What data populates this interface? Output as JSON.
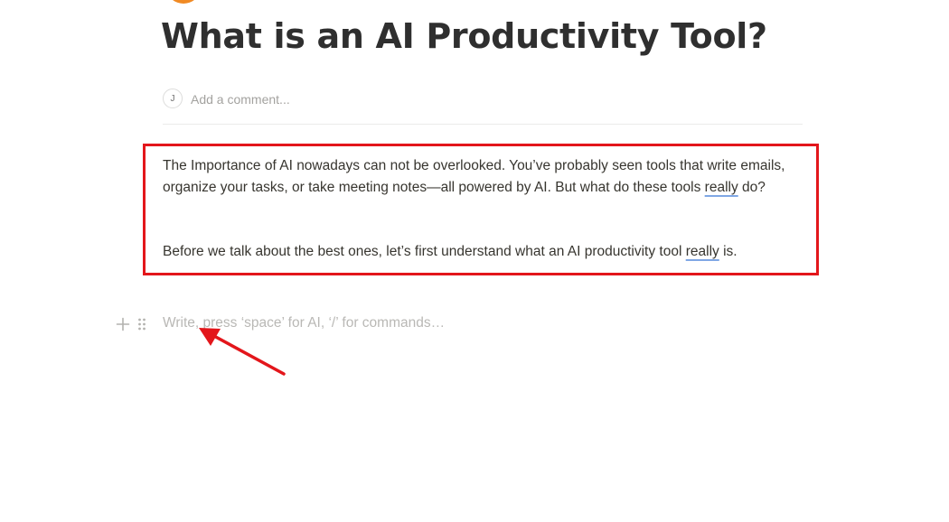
{
  "page": {
    "icon": "emoji-icon",
    "title": "What is an AI Productivity Tool?"
  },
  "comment": {
    "avatar_initial": "J",
    "placeholder": "Add a comment..."
  },
  "content": {
    "p1_text_before": "The Importance of AI nowadays can not be overlooked.  You’ve probably seen tools that write emails, organize your tasks, or take meeting notes—all powered by AI. But what do these tools ",
    "p1_flagged_word": "really",
    "p1_text_after": " do?",
    "p2_text_before": " Before we talk about the best ones, let’s first understand what an AI productivity tool ",
    "p2_flagged_word": "really",
    "p2_text_after": " is."
  },
  "editor": {
    "add_block_icon": "plus-icon",
    "drag_handle_icon": "drag-handle-icon",
    "placeholder": "Write, press ‘space’ for AI, ‘/’ for commands…"
  },
  "annotations": {
    "highlight_color": "#e3161b",
    "arrow_color": "#e3161b"
  }
}
